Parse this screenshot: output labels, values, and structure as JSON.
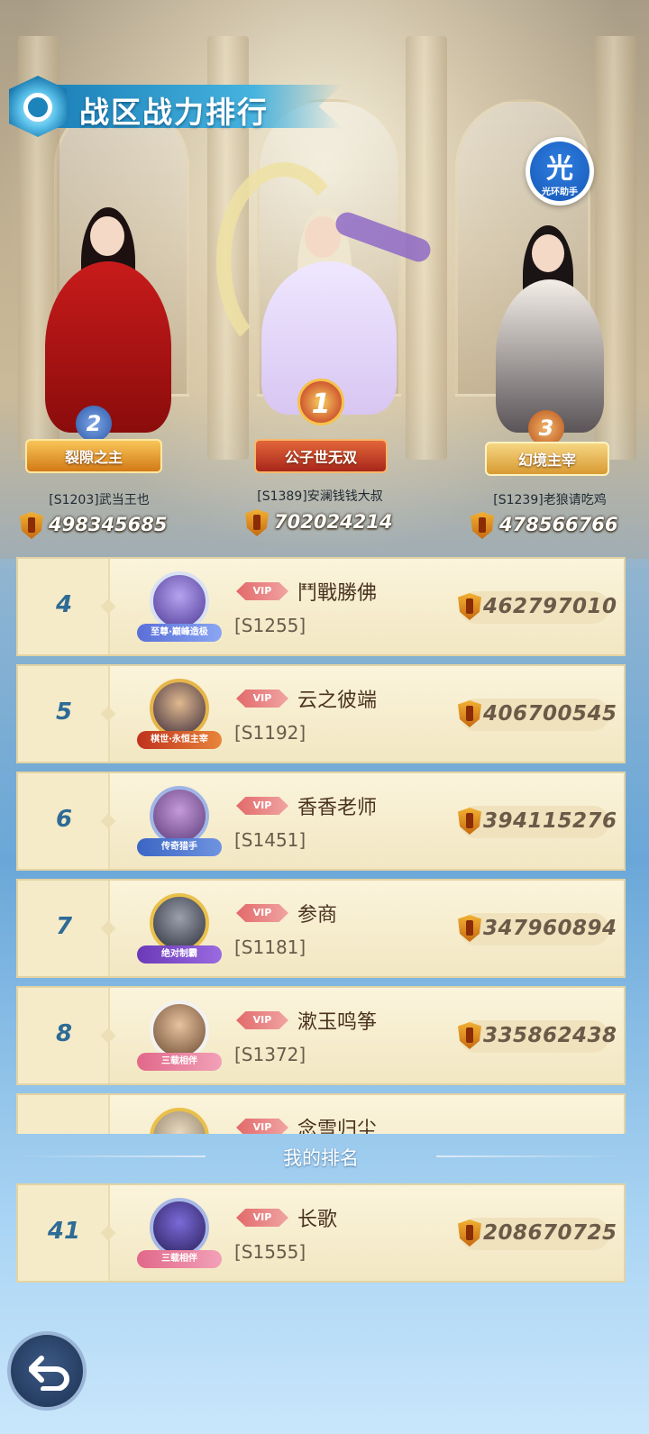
{
  "header": {
    "title": "战区战力排行",
    "helper_glyph": "光",
    "helper_caption": "光环助手"
  },
  "podium": [
    {
      "rank": "1",
      "title": "公子世无双",
      "name": "[S1389]安澜钱钱大叔",
      "power": "702024214"
    },
    {
      "rank": "2",
      "title": "裂隙之主",
      "name": "[S1203]武当王也",
      "power": "498345685"
    },
    {
      "rank": "3",
      "title": "幻境主宰",
      "name": "[S1239]老狼请吃鸡",
      "power": "478566766"
    }
  ],
  "rankings": [
    {
      "rank": "4",
      "vip": "VIP",
      "name": "鬥戰勝佛",
      "server": "[S1255]",
      "power": "462797010",
      "frame": "至尊·巅峰造极"
    },
    {
      "rank": "5",
      "vip": "VIP",
      "name": "云之彼端",
      "server": "[S1192]",
      "power": "406700545",
      "frame": "棋世·永恒主宰"
    },
    {
      "rank": "6",
      "vip": "VIP",
      "name": "香香老师",
      "server": "[S1451]",
      "power": "394115276",
      "frame": "传奇猎手"
    },
    {
      "rank": "7",
      "vip": "VIP",
      "name": "参商",
      "server": "[S1181]",
      "power": "347960894",
      "frame": "绝对制霸"
    },
    {
      "rank": "8",
      "vip": "VIP",
      "name": "漱玉鸣筝",
      "server": "[S1372]",
      "power": "335862438",
      "frame": "三载相伴"
    },
    {
      "rank": "",
      "vip": "VIP",
      "name": "念雪归尘",
      "server": "",
      "power": "",
      "frame": ""
    }
  ],
  "my_rank": {
    "label": "我的排名",
    "rank": "41",
    "vip": "VIP",
    "name": "长歌",
    "server": "[S1555]",
    "power": "208670725",
    "frame": "三载相伴"
  },
  "icons": {
    "title_emblem": "crest-icon",
    "power": "power-shield-icon",
    "back": "back-arrow-icon"
  },
  "colors": {
    "accent_blue": "#1a7fb7",
    "rank_number": "#2e6b96",
    "row_bg": "#fbf4dc"
  }
}
